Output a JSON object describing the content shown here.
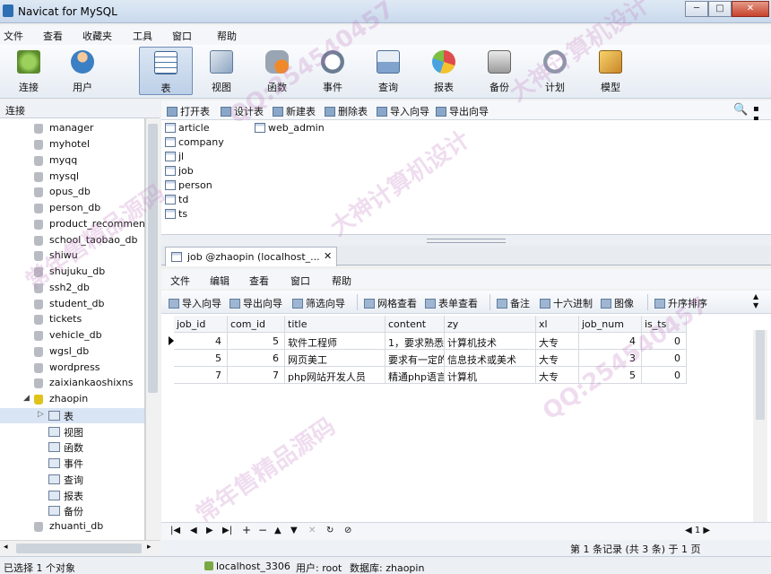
{
  "window": {
    "title": "Navicat for MySQL",
    "min_label": "─",
    "max_label": "□",
    "close_label": "✕"
  },
  "menu": [
    "文件",
    "查看",
    "收藏夹",
    "工具",
    "窗口",
    "帮助"
  ],
  "toolbar": [
    {
      "label": "连接",
      "icon": "connect-icon"
    },
    {
      "label": "用户",
      "icon": "user-icon"
    },
    {
      "label": "表",
      "icon": "table-icon",
      "active": true
    },
    {
      "label": "视图",
      "icon": "view-icon"
    },
    {
      "label": "函数",
      "icon": "function-icon"
    },
    {
      "label": "事件",
      "icon": "event-icon"
    },
    {
      "label": "查询",
      "icon": "query-icon"
    },
    {
      "label": "报表",
      "icon": "report-icon"
    },
    {
      "label": "备份",
      "icon": "backup-icon"
    },
    {
      "label": "计划",
      "icon": "schedule-icon"
    },
    {
      "label": "模型",
      "icon": "model-icon"
    }
  ],
  "sidebar": {
    "header": "连接",
    "databases": [
      "manager",
      "myhotel",
      "myqq",
      "mysql",
      "opus_db",
      "person_db",
      "product_recommend",
      "school_taobao_db",
      "shiwu",
      "shujuku_db",
      "ssh2_db",
      "student_db",
      "tickets",
      "vehicle_db",
      "wgsl_db",
      "wordpress",
      "zaixiankaoshixns",
      "zhaopin"
    ],
    "open_db_children": [
      "表",
      "视图",
      "函数",
      "事件",
      "查询",
      "报表",
      "备份"
    ],
    "after": [
      "zhuanti_db"
    ],
    "scroll_left": "◂",
    "scroll_right": "▸"
  },
  "object_toolbar": [
    "打开表",
    "设计表",
    "新建表",
    "删除表",
    "导入向导",
    "导出向导"
  ],
  "object_toolbar_extra": {
    "search": "🔍",
    "views": "▪ ▪ ▪"
  },
  "tables_col1": [
    "article",
    "company",
    "jl",
    "job",
    "person",
    "td",
    "ts"
  ],
  "tables_col2": [
    "web_admin"
  ],
  "doc_tab": {
    "label": "job @zhaopin (localhost_...",
    "close": "✕"
  },
  "inner_menu": [
    "文件",
    "编辑",
    "查看",
    "窗口",
    "帮助"
  ],
  "inner_toolbar": [
    "导入向导",
    "导出向导",
    "筛选向导",
    "网格查看",
    "表单查看",
    "备注",
    "十六进制",
    "图像",
    "升序排序"
  ],
  "inner_toolbar_more": "▲\n▼",
  "grid": {
    "columns": [
      "job_id",
      "com_id",
      "title",
      "content",
      "zy",
      "xl",
      "job_num",
      "is_ts"
    ],
    "rows": [
      [
        "4",
        "5",
        "软件工程师",
        "1，要求熟悉",
        "计算机技术",
        "大专",
        "4",
        "0"
      ],
      [
        "5",
        "6",
        "网页美工",
        "要求有一定的",
        "信息技术或美术",
        "大专",
        "3",
        "0"
      ],
      [
        "7",
        "7",
        "php网站开发人员",
        "精通php语言",
        "计算机",
        "大专",
        "5",
        "0"
      ]
    ]
  },
  "nav_buttons": [
    "|◀",
    "◀",
    "▶",
    "▶|",
    "+",
    "−",
    "▲",
    "▼",
    "✕",
    "↻",
    "⊘"
  ],
  "nav_page": "◀  1  ▶",
  "record_info": "第 1 条记录 (共 3 条) 于 1 页",
  "status": {
    "selected": "已选择 1 个对象",
    "connection": "localhost_3306",
    "user": "用户: root",
    "database": "数据库: zhaopin"
  },
  "watermarks": [
    "QQ:254540457",
    "大神计算机设计",
    "常年售精品源码",
    "QQ:254540457",
    "大神计算机设计",
    "常年售精品源码"
  ]
}
